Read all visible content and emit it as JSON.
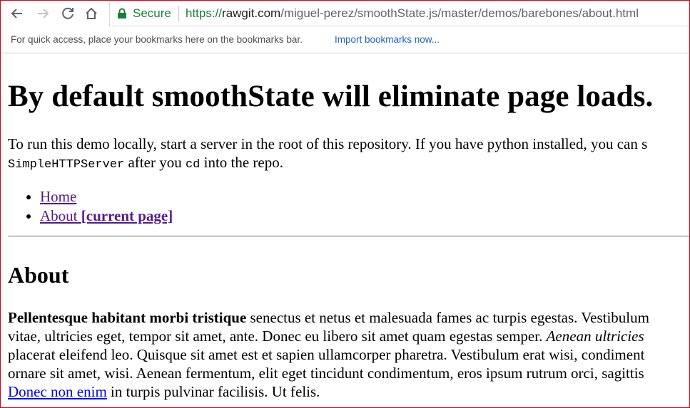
{
  "browser": {
    "secure_label": "Secure",
    "url_scheme": "https://",
    "url_host": "rawgit.com",
    "url_path": "/miguel-perez/smoothState.js/master/demos/barebones/about.html"
  },
  "bookmarks_bar": {
    "message": "For quick access, place your bookmarks here on the bookmarks bar.",
    "import_link": "Import bookmarks now..."
  },
  "page": {
    "heading": "By default smoothState will eliminate page loads.",
    "intro": {
      "line1": "To run this demo locally, start a server in the root of this repository. If you have python installed, you can s",
      "code1": "SimpleHTTPServer",
      "text_after_code1": " after you ",
      "code2": "cd",
      "text_after_code2": " into the repo."
    },
    "nav": [
      {
        "label": "Home"
      },
      {
        "label": "About ",
        "current": "[current page]"
      }
    ],
    "section_title": "About",
    "paragraph": {
      "bold": "Pellentesque habitant morbi tristique",
      "line1_rest": " senectus et netus et malesuada fames ac turpis egestas. Vestibulum",
      "line2": "vitae, ultricies eget, tempor sit amet, ante. Donec eu libero sit amet quam egestas semper. ",
      "line2_italic": "Aenean ultricies",
      "line3": "placerat eleifend leo. Quisque sit amet est et sapien ullamcorper pharetra. Vestibulum erat wisi, condiment",
      "line4": "ornare sit amet, wisi. Aenean fermentum, elit eget tincidunt condimentum, eros ipsum rutrum orci, sagittis",
      "link": "Donec non enim",
      "line5_rest": " in turpis pulvinar facilisis. Ut felis."
    }
  },
  "colors": {
    "secure_green": "#188038",
    "visited_link": "#551a8b",
    "unvisited_link": "#0000ee",
    "frame_border": "#d0021b"
  }
}
